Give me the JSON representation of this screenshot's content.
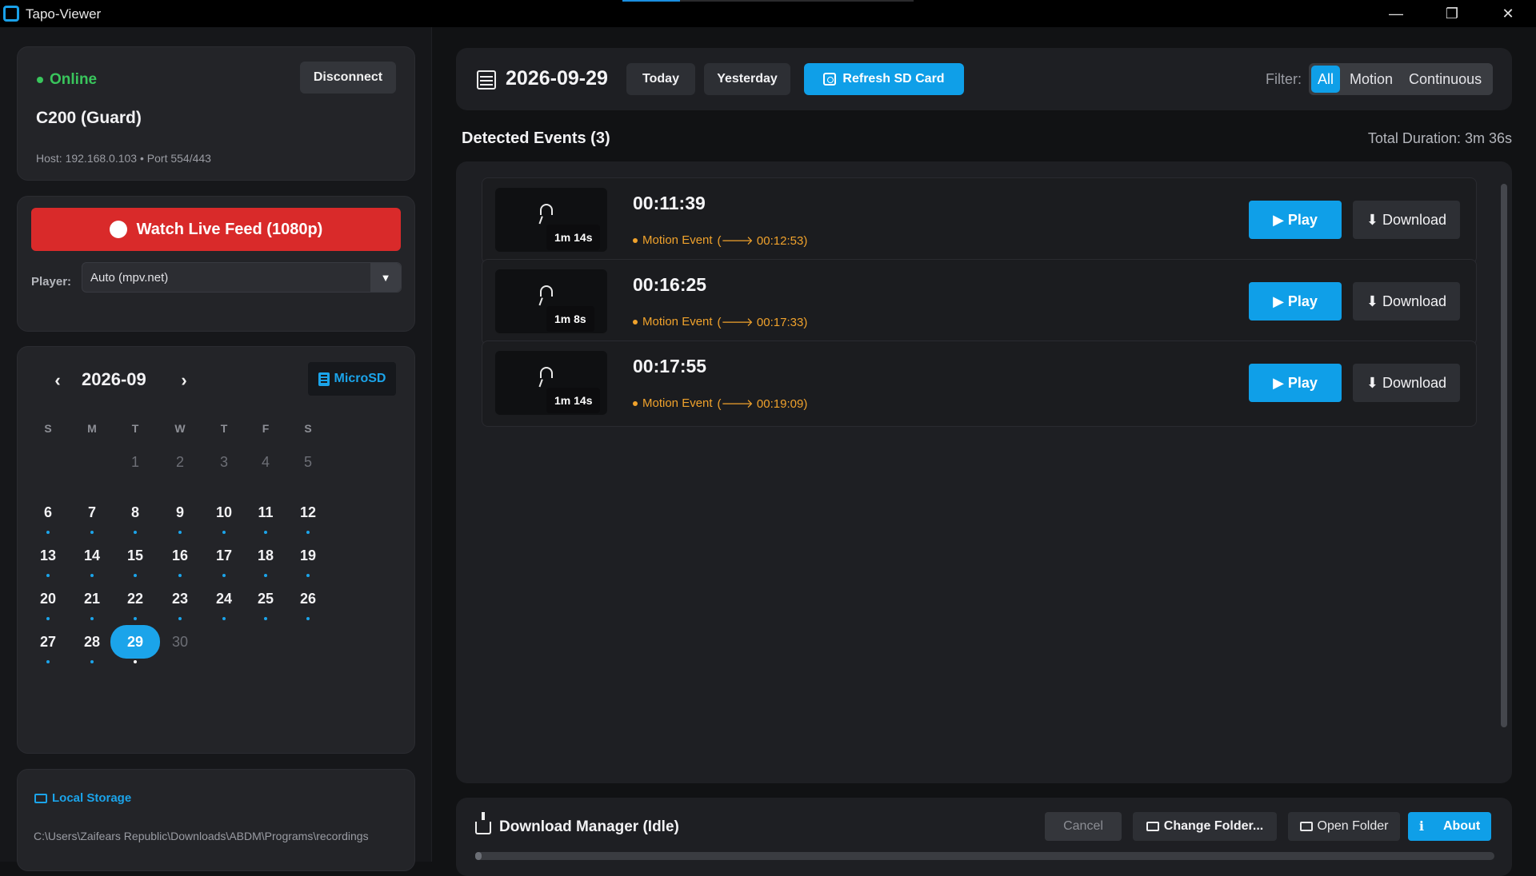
{
  "window": {
    "title": "Tapo-Viewer",
    "minimize": "—",
    "maximize": "❐",
    "close": "✕"
  },
  "status": {
    "online": "Online",
    "disconnect": "Disconnect",
    "device": "C200 (Guard)",
    "host": "Host: 192.168.0.103 • Port 554/443"
  },
  "live": {
    "watch": "Watch Live Feed (1080p)",
    "player_label": "Player:",
    "player_value": "Auto (mpv.net)"
  },
  "calendar": {
    "prev": "‹",
    "month": "2026-09",
    "next": "›",
    "microsd": "MicroSD",
    "dow": [
      "S",
      "M",
      "T",
      "W",
      "T",
      "F",
      "S"
    ],
    "weeks": [
      [
        "",
        "",
        "1",
        "2",
        "3",
        "4",
        "5"
      ],
      [
        "6",
        "7",
        "8",
        "9",
        "10",
        "11",
        "12"
      ],
      [
        "13",
        "14",
        "15",
        "16",
        "17",
        "18",
        "19"
      ],
      [
        "20",
        "21",
        "22",
        "23",
        "24",
        "25",
        "26"
      ],
      [
        "27",
        "28",
        "29",
        "30",
        "",
        "",
        ""
      ]
    ],
    "recorded_days": [
      "6",
      "7",
      "8",
      "9",
      "10",
      "11",
      "12",
      "13",
      "14",
      "15",
      "16",
      "17",
      "18",
      "19",
      "20",
      "21",
      "22",
      "23",
      "24",
      "25",
      "26",
      "27",
      "28",
      "29"
    ],
    "selected": "29"
  },
  "storage": {
    "title": "Local Storage",
    "path": "C:\\Users\\Zaifears Republic\\Downloads\\ABDM\\Programs\\recordings"
  },
  "topbar": {
    "date": "2026-09-29",
    "today": "Today",
    "yesterday": "Yesterday",
    "refresh": "Refresh SD Card",
    "filter_label": "Filter:",
    "filters": [
      "All",
      "Motion",
      "Continuous"
    ],
    "active_filter": "All"
  },
  "events": {
    "title": "Detected Events (3)",
    "total_duration": "Total Duration: 3m 36s",
    "items": [
      {
        "time": "00:11:39",
        "duration": "1m 14s",
        "type": "Motion Event",
        "end": "(🡒 00:12:53)",
        "play": "▶ Play",
        "download": "⬇ Download"
      },
      {
        "time": "00:16:25",
        "duration": "1m 8s",
        "type": "Motion Event",
        "end": "(🡒 00:17:33)",
        "play": "▶ Play",
        "download": "⬇ Download"
      },
      {
        "time": "00:17:55",
        "duration": "1m 14s",
        "type": "Motion Event",
        "end": "(🡒 00:19:09)",
        "play": "▶ Play",
        "download": "⬇ Download"
      }
    ]
  },
  "downloads": {
    "title": "Download Manager (Idle)",
    "cancel": "Cancel",
    "change_folder": "Change Folder...",
    "open_folder": "Open Folder",
    "about_icon": "ℹ",
    "about": "About",
    "progress": 0
  },
  "colors": {
    "accent": "#0f9fe8",
    "online": "#39c55c",
    "live": "#d92a2a",
    "motion": "#f0a22c"
  },
  "icons": [
    "app-icon",
    "calendar-icon",
    "refresh-icon",
    "microsd-icon",
    "folder-icon",
    "download-icon",
    "info-icon"
  ]
}
